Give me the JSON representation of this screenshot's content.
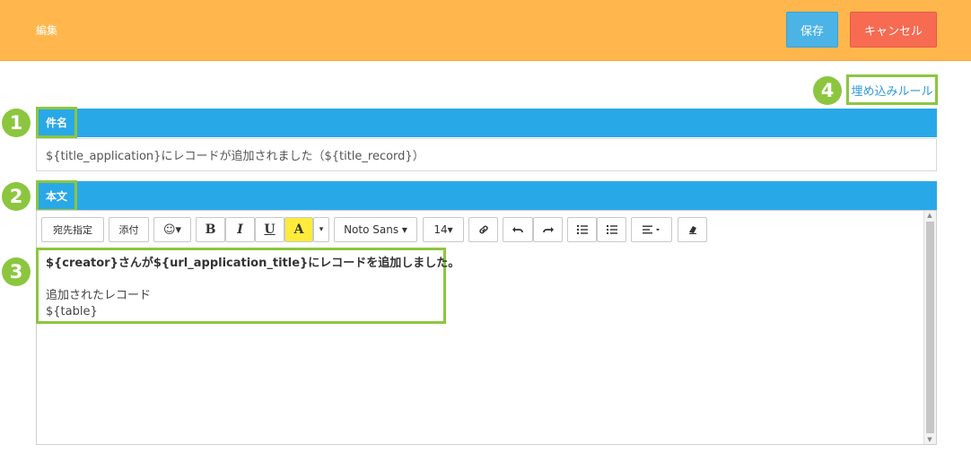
{
  "header": {
    "title": "編集",
    "save_label": "保存",
    "cancel_label": "キャンセル"
  },
  "markers": [
    "1",
    "2",
    "3",
    "4"
  ],
  "rule_link": "埋め込みルール",
  "subject": {
    "label": "件名",
    "value": "${title_application}にレコードが追加されました（${title_record}）"
  },
  "body": {
    "label": "本文",
    "lines": [
      "${creator}さんが${url_application_title}にレコードを追加しました。",
      "",
      "追加されたレコード",
      "${table}"
    ]
  },
  "toolbar": {
    "recipient": "宛先指定",
    "attach": "添付",
    "emoji": "☺▾",
    "bold": "B",
    "italic": "I",
    "underline": "U",
    "highlight": "A",
    "highlight_caret": "▾",
    "font": "Noto Sans ▾",
    "size": "14▾",
    "icons": {
      "link": "link-icon",
      "undo": "undo-icon",
      "redo": "redo-icon",
      "ul": "bullet-list-icon",
      "ol": "numbered-list-icon",
      "align": "align-icon",
      "eraser": "eraser-icon"
    }
  },
  "colors": {
    "header": "#ffb74d",
    "bar": "#29a8e8",
    "marker": "#8cc63f",
    "save": "#4bb3e6",
    "cancel": "#f66b52"
  }
}
